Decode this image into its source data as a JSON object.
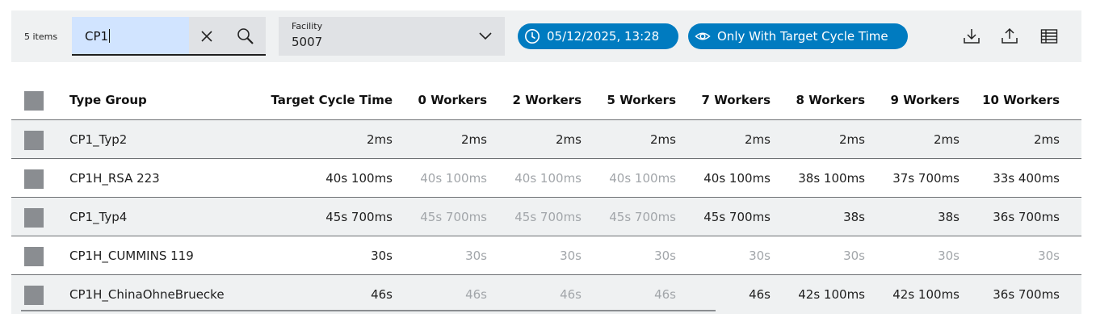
{
  "toolbar": {
    "items_count": "5 items",
    "search": {
      "value": "CP1"
    },
    "facility": {
      "label": "Facility",
      "value": "5007"
    },
    "date_filter": "05/12/2025, 13:28",
    "cycle_filter": "Only With Target Cycle Time",
    "icons": [
      "clear-icon",
      "search-icon",
      "chevron-down-icon",
      "clock-icon",
      "eye-icon",
      "download-icon",
      "upload-icon",
      "table-columns-icon"
    ]
  },
  "colors": {
    "accent": "#007bc0",
    "muted_text": "#a2a6aa",
    "row_shade": "#eff1f2",
    "search_highlight": "#d1e4ff"
  },
  "table": {
    "columns": [
      "Type Group",
      "Target Cycle Time",
      "0 Workers",
      "2 Workers",
      "5 Workers",
      "7 Workers",
      "8 Workers",
      "9 Workers",
      "10 Workers"
    ],
    "rows": [
      {
        "name": "CP1_Typ2",
        "values": [
          "2ms",
          "2ms",
          "2ms",
          "2ms",
          "2ms",
          "2ms",
          "2ms",
          "2ms"
        ]
      },
      {
        "name": "CP1H_RSA 223",
        "values": [
          "40s 100ms",
          "40s 100ms",
          "40s 100ms",
          "40s 100ms",
          "40s 100ms",
          "38s 100ms",
          "37s 700ms",
          "33s 400ms"
        ]
      },
      {
        "name": "CP1_Typ4",
        "values": [
          "45s 700ms",
          "45s 700ms",
          "45s 700ms",
          "45s 700ms",
          "45s 700ms",
          "38s",
          "38s",
          "36s 700ms"
        ]
      },
      {
        "name": "CP1H_CUMMINS 119",
        "values": [
          "30s",
          "30s",
          "30s",
          "30s",
          "30s",
          "30s",
          "30s",
          "30s"
        ]
      },
      {
        "name": "CP1H_ChinaOhneBruecke",
        "values": [
          "46s",
          "46s",
          "46s",
          "46s",
          "46s",
          "42s 100ms",
          "42s 100ms",
          "36s 700ms"
        ]
      }
    ]
  }
}
